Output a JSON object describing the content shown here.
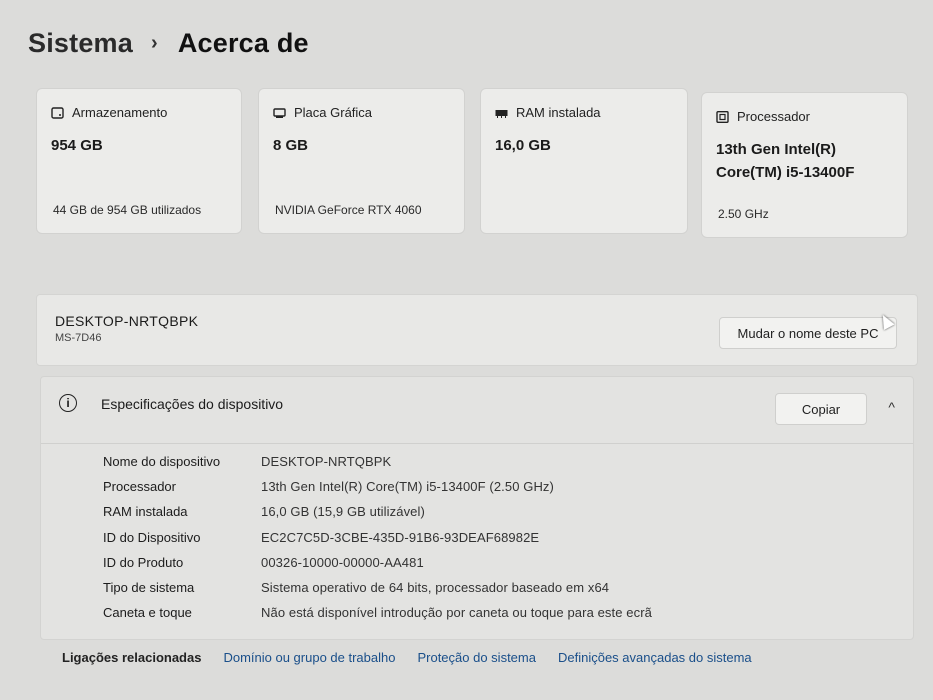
{
  "breadcrumb": {
    "parent": "Sistema",
    "separator": "›",
    "current": "Acerca de"
  },
  "cards": [
    {
      "title": "Armazenamento",
      "icon": "storage-icon",
      "value": "954 GB",
      "sub": "44 GB de 954 GB utilizados"
    },
    {
      "title": "Placa Gráfica",
      "icon": "gpu-icon",
      "value": "8 GB",
      "sub": "NVIDIA GeForce RTX 4060"
    },
    {
      "title": "RAM instalada",
      "icon": "ram-icon",
      "value": "16,0 GB",
      "sub": ""
    },
    {
      "title": "Processador",
      "icon": "cpu-icon",
      "value_line1": "13th Gen Intel(R)",
      "value_line2": "Core(TM) i5-13400F",
      "sub": "2.50 GHz"
    }
  ],
  "pc": {
    "name": "DESKTOP-NRTQBPK",
    "model": "MS-7D46",
    "rename_label": "Mudar o nome deste PC"
  },
  "specs": {
    "title": "Especificações do dispositivo",
    "copy_label": "Copiar",
    "chevron": "^",
    "rows": [
      {
        "label": "Nome do dispositivo",
        "value": "DESKTOP-NRTQBPK"
      },
      {
        "label": "Processador",
        "value": "13th Gen Intel(R) Core(TM) i5-13400F (2.50 GHz)"
      },
      {
        "label": "RAM instalada",
        "value": "16,0 GB (15,9 GB utilizável)"
      },
      {
        "label": "ID do Dispositivo",
        "value": "EC2C7C5D-3CBE-435D-91B6-93DEAF68982E"
      },
      {
        "label": "ID do Produto",
        "value": "00326-10000-00000-AA481"
      },
      {
        "label": "Tipo de sistema",
        "value": "Sistema operativo de 64 bits, processador baseado em x64"
      },
      {
        "label": "Caneta e toque",
        "value": "Não está disponível introdução por caneta ou toque para este ecrã"
      }
    ]
  },
  "related": {
    "label": "Ligações relacionadas",
    "links": [
      "Domínio ou grupo de trabalho",
      "Proteção do sistema",
      "Definições avançadas do sistema"
    ]
  },
  "colors": {
    "background": "#dcdcda",
    "card": "#ececea",
    "link": "#1a4f8a"
  }
}
